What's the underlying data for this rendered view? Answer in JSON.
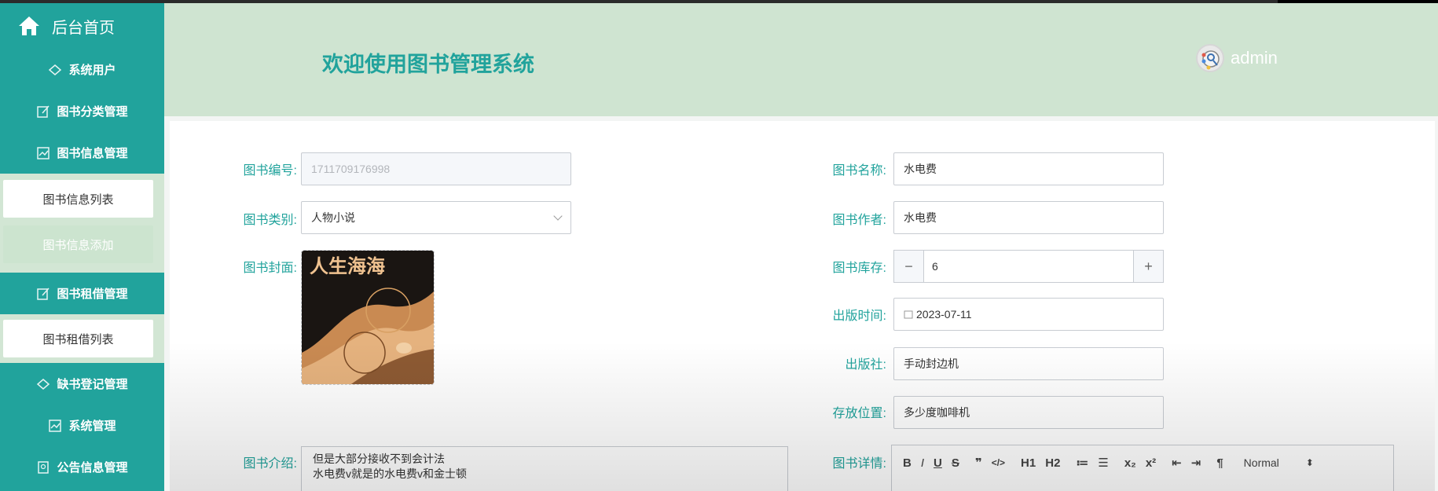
{
  "colors": {
    "accent": "#21a39c",
    "header_bg": "#cfe4d1",
    "sidebar_bg": "#21a39c"
  },
  "sidebar": {
    "brand": "后台首页",
    "items": [
      {
        "label": "系统用户",
        "icon": "gem-icon"
      },
      {
        "label": "图书分类管理",
        "icon": "edit-icon"
      },
      {
        "label": "图书信息管理",
        "icon": "chart-icon"
      },
      {
        "label": "图书租借管理",
        "icon": "edit-icon"
      },
      {
        "label": "缺书登记管理",
        "icon": "gem-icon"
      },
      {
        "label": "系统管理",
        "icon": "chart-icon"
      },
      {
        "label": "公告信息管理",
        "icon": "doc-icon"
      }
    ],
    "book_info_sub": [
      "图书信息列表",
      "图书信息添加"
    ],
    "rental_sub": [
      "图书租借列表"
    ]
  },
  "header": {
    "title": "欢迎使用图书管理系统",
    "username": "admin"
  },
  "form": {
    "book_no": {
      "label": "图书编号:",
      "value": "1711709176998"
    },
    "book_name": {
      "label": "图书名称:",
      "value": "水电费"
    },
    "category": {
      "label": "图书类别:",
      "value": "人物小说"
    },
    "author": {
      "label": "图书作者:",
      "value": "水电费"
    },
    "cover": {
      "label": "图书封面:",
      "cover_title": "人生海海"
    },
    "stock": {
      "label": "图书库存:",
      "value": "6",
      "minus": "−",
      "plus": "+"
    },
    "publish_date": {
      "label": "出版时间:",
      "value": "2023-07-11"
    },
    "publisher": {
      "label": "出版社:",
      "value": "手动封边机"
    },
    "location": {
      "label": "存放位置:",
      "value": "多少度咖啡机"
    },
    "intro": {
      "label": "图书介绍:",
      "line1": "但是大部分接收不到会计法",
      "line2": "水电费v就是的水电费v和金士顿"
    },
    "detail": {
      "label": "图书详情:",
      "toolbar": [
        "B",
        "I",
        "U",
        "S",
        "❞",
        "</>",
        "H1",
        "H2",
        "≔",
        "☰",
        "x₂",
        "x²",
        "⇤",
        "⇥",
        "¶"
      ],
      "format": "Normal"
    }
  }
}
